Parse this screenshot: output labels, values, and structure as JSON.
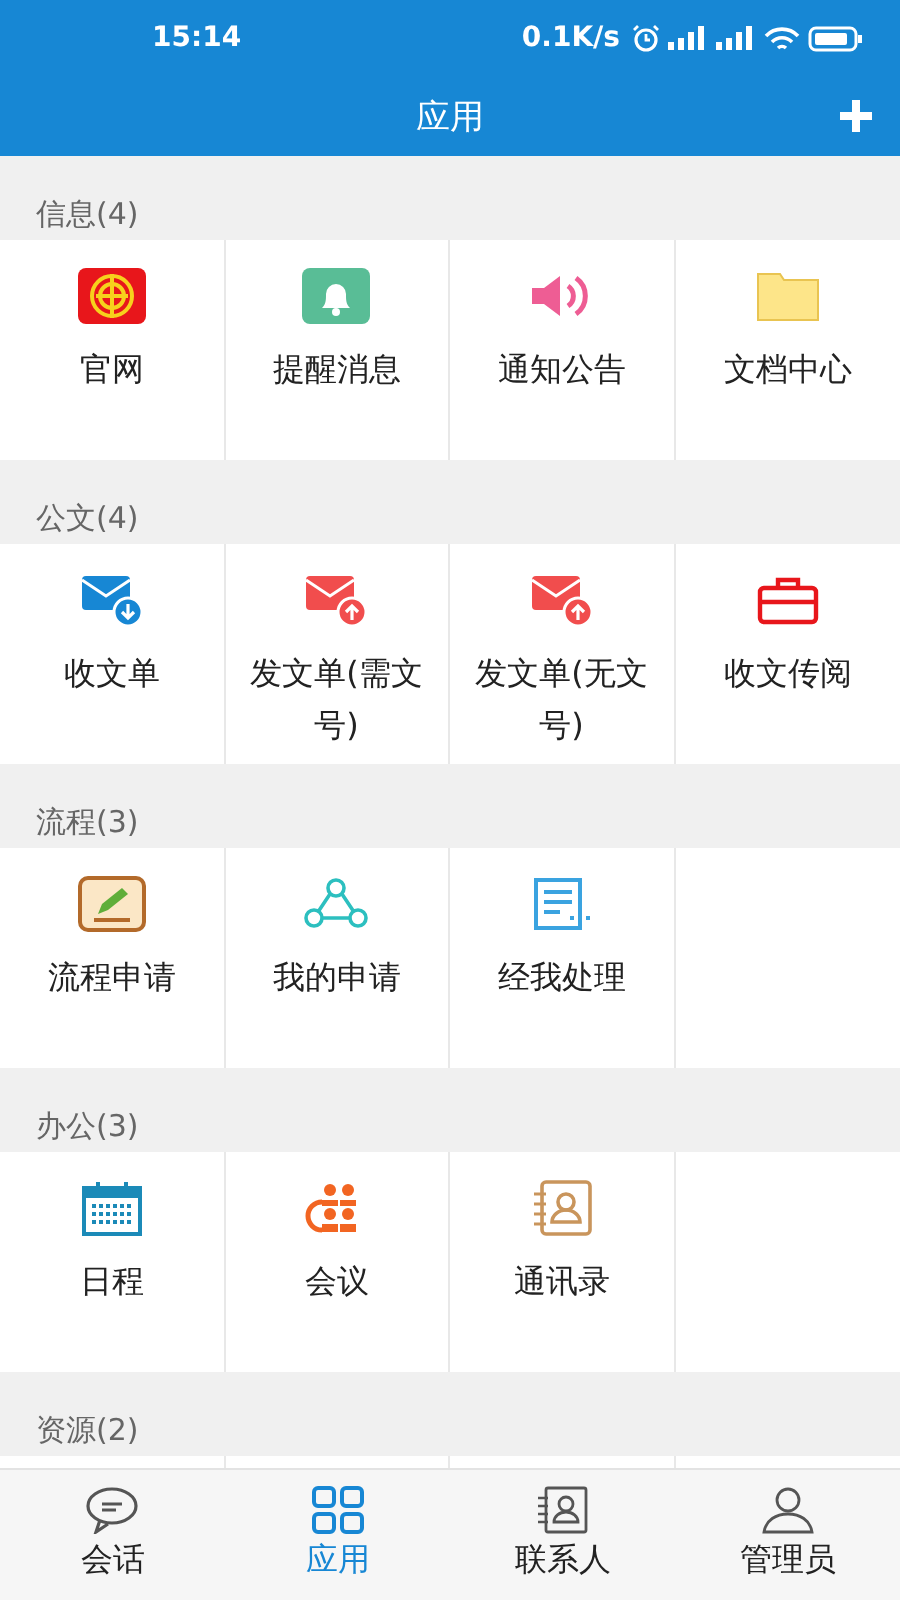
{
  "status_bar": {
    "time": "15:14",
    "net_speed": "0.1K/s"
  },
  "header": {
    "title": "应用"
  },
  "sections": [
    {
      "title": "信息(4)",
      "items": [
        {
          "label": "官网"
        },
        {
          "label": "提醒消息"
        },
        {
          "label": "通知公告"
        },
        {
          "label": "文档中心"
        }
      ]
    },
    {
      "title": "公文(4)",
      "items": [
        {
          "label": "收文单"
        },
        {
          "label": "发文单(需文号)"
        },
        {
          "label": "发文单(无文号)"
        },
        {
          "label": "收文传阅"
        }
      ]
    },
    {
      "title": "流程(3)",
      "items": [
        {
          "label": "流程申请"
        },
        {
          "label": "我的申请"
        },
        {
          "label": "经我处理"
        }
      ]
    },
    {
      "title": "办公(3)",
      "items": [
        {
          "label": "日程"
        },
        {
          "label": "会议"
        },
        {
          "label": "通讯录"
        }
      ]
    },
    {
      "title": "资源(2)"
    }
  ],
  "tabs": [
    {
      "label": "会话",
      "selected": false
    },
    {
      "label": "应用",
      "selected": true
    },
    {
      "label": "联系人",
      "selected": false
    },
    {
      "label": "管理员",
      "selected": false
    }
  ]
}
